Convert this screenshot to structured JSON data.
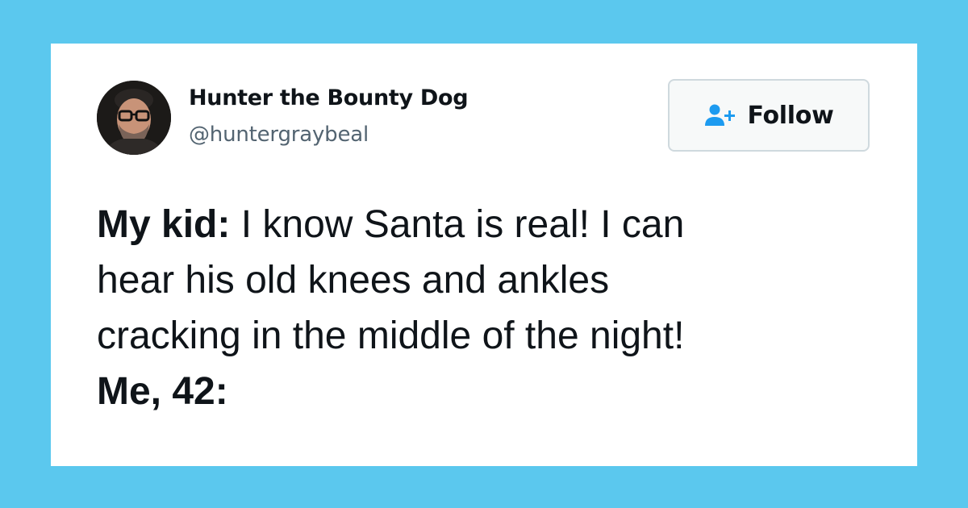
{
  "author": {
    "display_name": "Hunter the Bounty Dog",
    "handle": "@huntergraybeal",
    "avatar_icon": "profile-photo"
  },
  "follow_button": {
    "label": "Follow",
    "icon": "add-user-icon",
    "icon_color": "#1d9bf0"
  },
  "tweet": {
    "line1_bold": "My kid:",
    "line1_text": " I know Santa is real! I can",
    "line2_text": "hear his old knees and ankles",
    "line3_text": "cracking in the middle of the night!",
    "line4_bold": "Me, 42:"
  },
  "colors": {
    "background": "#5bc8ee",
    "card": "#ffffff",
    "text": "#0f1419",
    "handle": "#536471"
  }
}
